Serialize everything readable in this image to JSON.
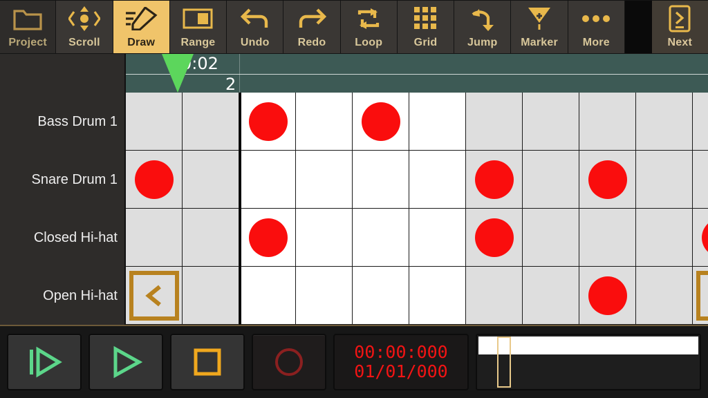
{
  "toolbar": {
    "buttons": [
      {
        "label": "Project",
        "icon": "folder-icon",
        "active": false,
        "dim": true
      },
      {
        "label": "Scroll",
        "icon": "move-icon",
        "active": false,
        "dim": false
      },
      {
        "label": "Draw",
        "icon": "pencil-icon",
        "active": true,
        "dim": false
      },
      {
        "label": "Range",
        "icon": "range-icon",
        "active": false,
        "dim": false
      },
      {
        "label": "Undo",
        "icon": "undo-icon",
        "active": false,
        "dim": false
      },
      {
        "label": "Redo",
        "icon": "redo-icon",
        "active": false,
        "dim": false
      },
      {
        "label": "Loop",
        "icon": "loop-icon",
        "active": false,
        "dim": false
      },
      {
        "label": "Grid",
        "icon": "grid-icon",
        "active": false,
        "dim": false
      },
      {
        "label": "Jump",
        "icon": "jump-icon",
        "active": false,
        "dim": false
      },
      {
        "label": "Marker",
        "icon": "marker-icon",
        "active": false,
        "dim": false
      },
      {
        "label": "More",
        "icon": "ellipsis-icon",
        "active": false,
        "dim": false
      },
      {
        "label": "Next",
        "icon": "next-page-icon",
        "active": false,
        "dim": false
      }
    ],
    "accent_color": "#f0c46a",
    "icon_color": "#e8b84b"
  },
  "ruler": {
    "time_label": "0:02",
    "bar_label": "2",
    "background_color": "#3d5a55",
    "playhead_color": "#5cd65c"
  },
  "grid": {
    "columns": 11,
    "shaded_color": "#dedede",
    "plain_color": "#ffffff",
    "note_color": "#fa0d0d",
    "nav_prev_label": "<",
    "nav_next_label": ">",
    "tracks": [
      {
        "name": "Bass Drum 1",
        "notes": [
          2,
          4
        ],
        "shaded": [
          0,
          1,
          6,
          7,
          8,
          9,
          10
        ]
      },
      {
        "name": "Snare Drum 1",
        "notes": [
          0,
          6,
          8
        ],
        "shaded": [
          0,
          1,
          6,
          7,
          8,
          9,
          10
        ]
      },
      {
        "name": "Closed Hi-hat",
        "notes": [
          2,
          6,
          10
        ],
        "shaded": [
          0,
          1,
          6,
          7,
          8,
          9,
          10
        ]
      },
      {
        "name": "Open Hi-hat",
        "notes": [
          8
        ],
        "shaded": [
          0,
          1,
          6,
          7,
          8,
          9,
          10
        ]
      }
    ]
  },
  "transport": {
    "buttons": [
      {
        "name": "go-to-start-play-button",
        "icon": "skip-play-icon"
      },
      {
        "name": "play-button",
        "icon": "play-icon"
      },
      {
        "name": "stop-button",
        "icon": "stop-icon"
      },
      {
        "name": "record-button",
        "icon": "record-icon"
      }
    ],
    "timecode_line1": "00:00:000",
    "timecode_line2": "01/01/000",
    "timecode_color": "#f21414",
    "play_color": "#5cd68a",
    "stop_color": "#f0a81e",
    "record_color": "#8b2020"
  }
}
